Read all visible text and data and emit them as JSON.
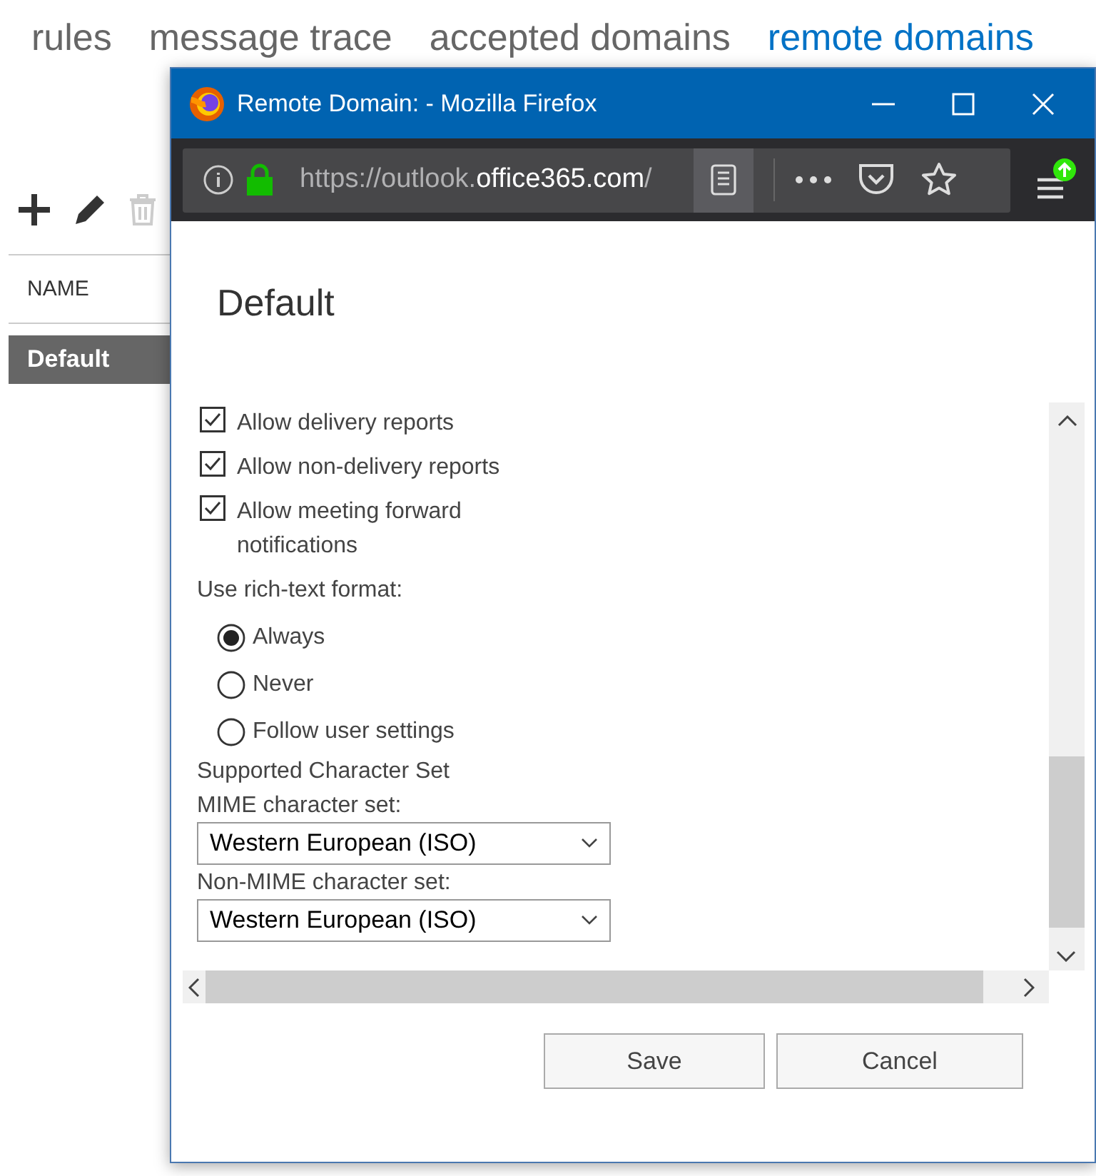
{
  "tabs": [
    {
      "label": "rules",
      "selected": false
    },
    {
      "label": "message trace",
      "selected": false
    },
    {
      "label": "accepted domains",
      "selected": false
    },
    {
      "label": "remote domains",
      "selected": true
    }
  ],
  "toolbar": [
    {
      "kind": "add",
      "disabled": false
    },
    {
      "kind": "edit",
      "disabled": false
    },
    {
      "kind": "delete",
      "disabled": true
    }
  ],
  "table": {
    "columns": [
      "NAME"
    ],
    "rows": [
      {
        "name": "Default",
        "selected": true
      }
    ]
  },
  "window": {
    "title": "Remote Domain: - Mozilla Firefox",
    "url_start": "https://outlook.",
    "url_host": "office365.com",
    "url_end": "/"
  },
  "form": {
    "heading": "Default",
    "checkboxes": [
      {
        "label": "Allow delivery reports",
        "checked": true
      },
      {
        "label": "Allow non-delivery reports",
        "checked": true
      },
      {
        "label": "Allow meeting forward notifications",
        "checked": true
      }
    ],
    "rich_text": {
      "label": "Use rich-text format:",
      "options": [
        {
          "label": "Always",
          "selected": true
        },
        {
          "label": "Never",
          "selected": false
        },
        {
          "label": "Follow user settings",
          "selected": false
        }
      ]
    },
    "section": "Supported Character Set",
    "selects": [
      {
        "label": "MIME character set:",
        "value": "Western European (ISO)"
      },
      {
        "label": "Non-MIME character set:",
        "value": "Western European (ISO)"
      }
    ]
  },
  "buttons": [
    "Save",
    "Cancel"
  ]
}
